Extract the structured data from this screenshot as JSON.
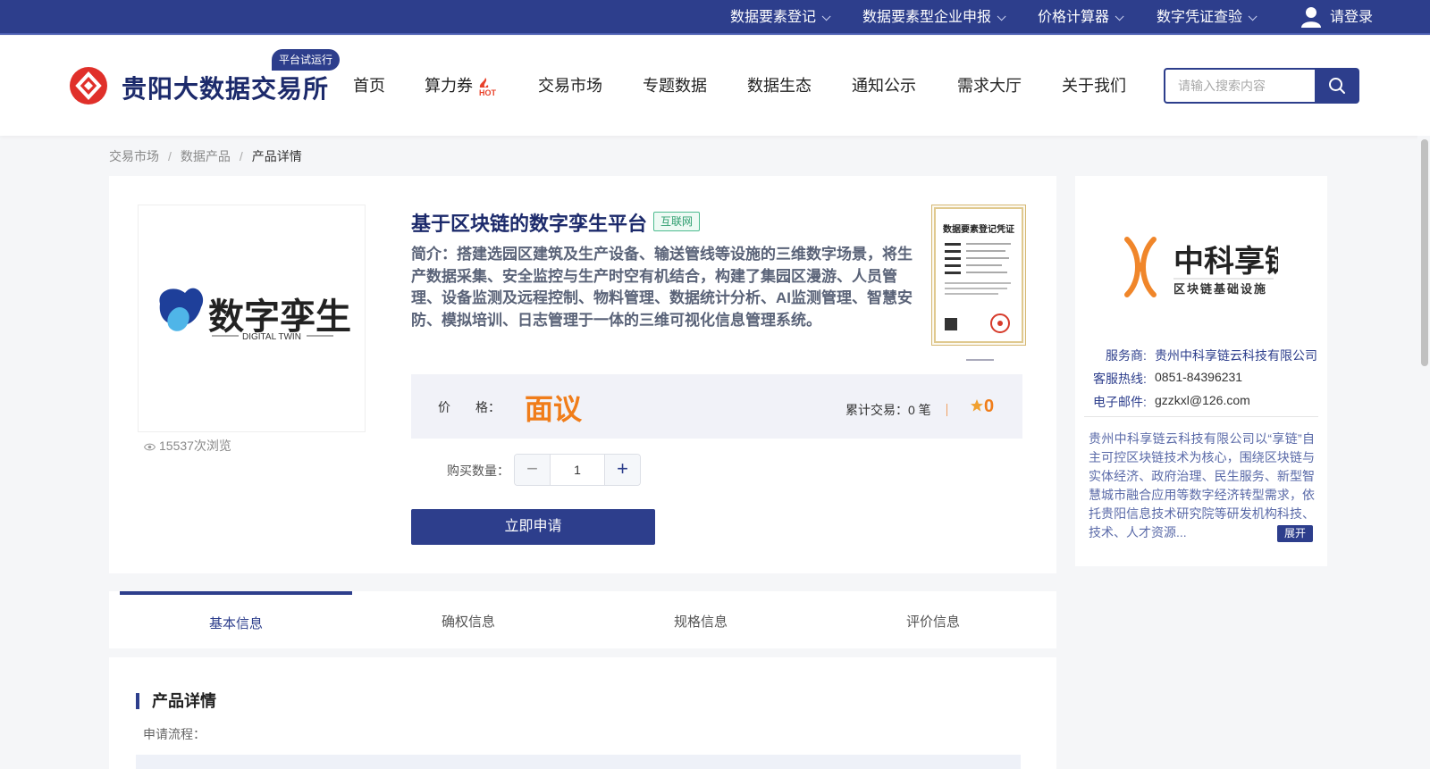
{
  "topbar": {
    "items": [
      {
        "label": "数据要素登记"
      },
      {
        "label": "数据要素型企业申报"
      },
      {
        "label": "价格计算器"
      },
      {
        "label": "数字凭证查验"
      }
    ],
    "login_label": "请登录"
  },
  "header": {
    "site_name": "贵阳大数据交易所",
    "trial_badge": "平台试运行",
    "nav": [
      {
        "label": "首页"
      },
      {
        "label": "算力券"
      },
      {
        "label": "交易市场"
      },
      {
        "label": "专题数据"
      },
      {
        "label": "数据生态"
      },
      {
        "label": "通知公示"
      },
      {
        "label": "需求大厅"
      },
      {
        "label": "关于我们"
      }
    ],
    "hot_badge": "HOT",
    "search_placeholder": "请输入搜索内容"
  },
  "breadcrumb": [
    "交易市场",
    "数据产品",
    "产品详情"
  ],
  "product": {
    "image_cn": "数字孪生",
    "image_en": "DIGITAL TWIN",
    "views": "15537次浏览",
    "title": "基于区块链的数字孪生平台",
    "tag": "互联网",
    "intro": "简介：搭建选园区建筑及生产设备、输送管线等设施的三维数字场景，将生产数据采集、安全监控与生产时空有机结合，构建了集园区漫游、人员管理、设备监测及远程控制、物料管理、数据统计分析、AI监测管理、智慧安防、模拟培训、日志管理于一体的三维可视化信息管理系统。",
    "cert_title": "数据要素登记凭证",
    "price_label": "价　　格：",
    "price_value": "面议",
    "trade_count": "累计交易：0 笔",
    "rating": "0",
    "qty_label": "购买数量：",
    "qty_value": "1",
    "apply_label": "立即申请"
  },
  "vendor": {
    "logo_cn": "中科享链",
    "logo_sub": "区块链基础设施",
    "provider_key": "服务商:",
    "provider_val": "贵州中科享链云科技有限公司",
    "hotline_key": "客服热线:",
    "hotline_val": "0851-84396231",
    "email_key": "电子邮件:",
    "email_val": "gzzkxl@126.com",
    "desc": "贵州中科享链云科技有限公司以“享链”自主可控区块链技术为核心，围绕区块链与实体经济、政府治理、民生服务、新型智慧城市融合应用等数字经济转型需求，依托贵阳信息技术研究院等研发机构科技、技术、人才资源...",
    "expand_label": "展开"
  },
  "tabs": [
    {
      "label": "基本信息"
    },
    {
      "label": "确权信息"
    },
    {
      "label": "规格信息"
    },
    {
      "label": "评价信息"
    }
  ],
  "detail": {
    "title": "产品详情",
    "flow_label": "申请流程："
  },
  "colors": {
    "brand": "#2d3e8c",
    "accent": "#f07d1a",
    "logo_red": "#e0302a",
    "vendor_orange": "#f0862a"
  }
}
